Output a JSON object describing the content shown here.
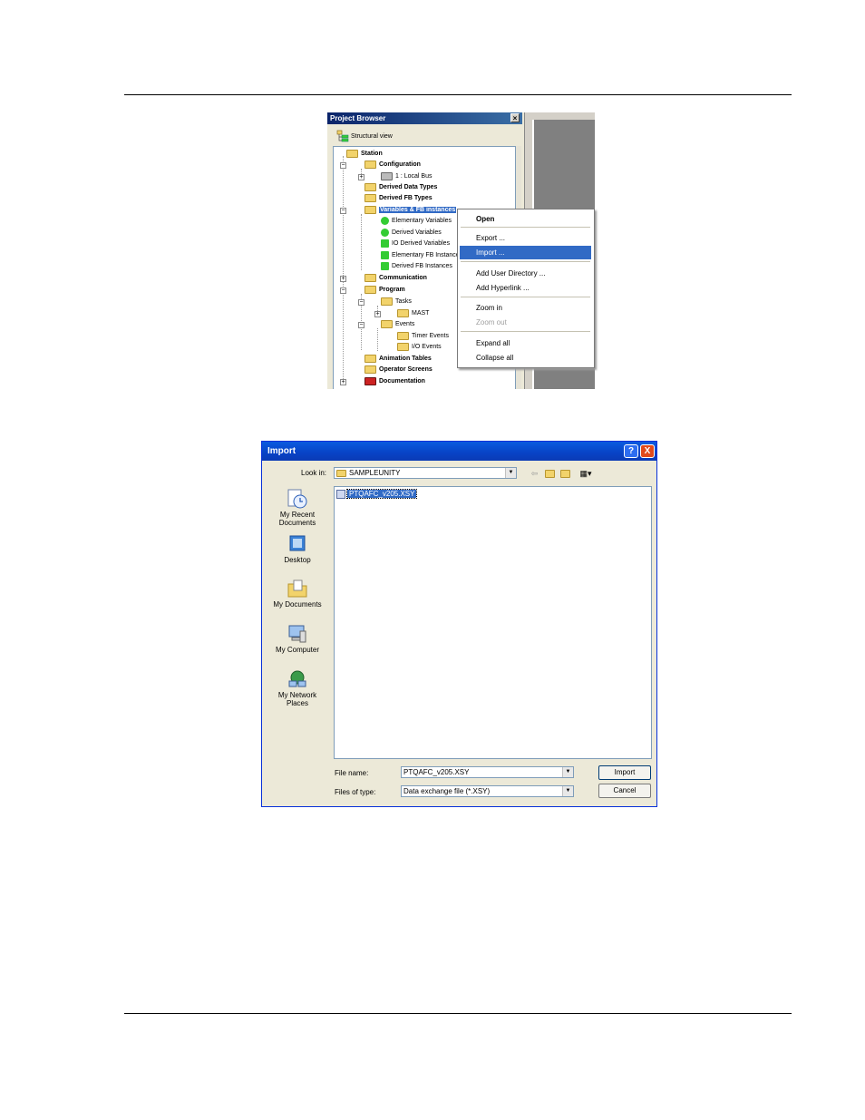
{
  "project_browser": {
    "title": "Project Browser",
    "close_glyph": "×",
    "structural_view": "Structural view",
    "tree": {
      "station": "Station",
      "configuration": "Configuration",
      "local_bus": "1 : Local Bus",
      "derived_data_types": "Derived Data Types",
      "derived_fb_types": "Derived FB Types",
      "variables_fb_instances": "Variables & FB instances",
      "elementary_variables": "Elementary Variables",
      "derived_variables": "Derived Variables",
      "io_derived_variables": "IO Derived Variables",
      "elementary_fb_instances": "Elementary FB Instances",
      "derived_fb_instances": "Derived FB Instances",
      "communication": "Communication",
      "program": "Program",
      "tasks": "Tasks",
      "mast": "MAST",
      "events": "Events",
      "timer_events": "Timer Events",
      "io_events": "I/O Events",
      "animation_tables": "Animation Tables",
      "operator_screens": "Operator Screens",
      "documentation": "Documentation"
    },
    "context_menu": {
      "open": "Open",
      "export": "Export ...",
      "import": "Import ...",
      "add_user_directory": "Add User Directory ...",
      "add_hyperlink": "Add Hyperlink ...",
      "zoom_in": "Zoom in",
      "zoom_out": "Zoom out",
      "expand_all": "Expand all",
      "collapse_all": "Collapse all"
    }
  },
  "import_dialog": {
    "title": "Import",
    "help_glyph": "?",
    "close_glyph": "X",
    "look_in_label": "Look in:",
    "look_in_value": "SAMPLEUNITY",
    "places": {
      "recent": "My Recent Documents",
      "desktop": "Desktop",
      "documents": "My Documents",
      "computer": "My Computer",
      "network": "My Network Places"
    },
    "files": [
      "PTQAFC_v205.XSY"
    ],
    "file_name_label": "File name:",
    "file_name_value": "PTQAFC_v205.XSY",
    "file_type_label": "Files of type:",
    "file_type_value": "Data exchange file (*.XSY)",
    "import_button": "Import",
    "cancel_button": "Cancel"
  }
}
